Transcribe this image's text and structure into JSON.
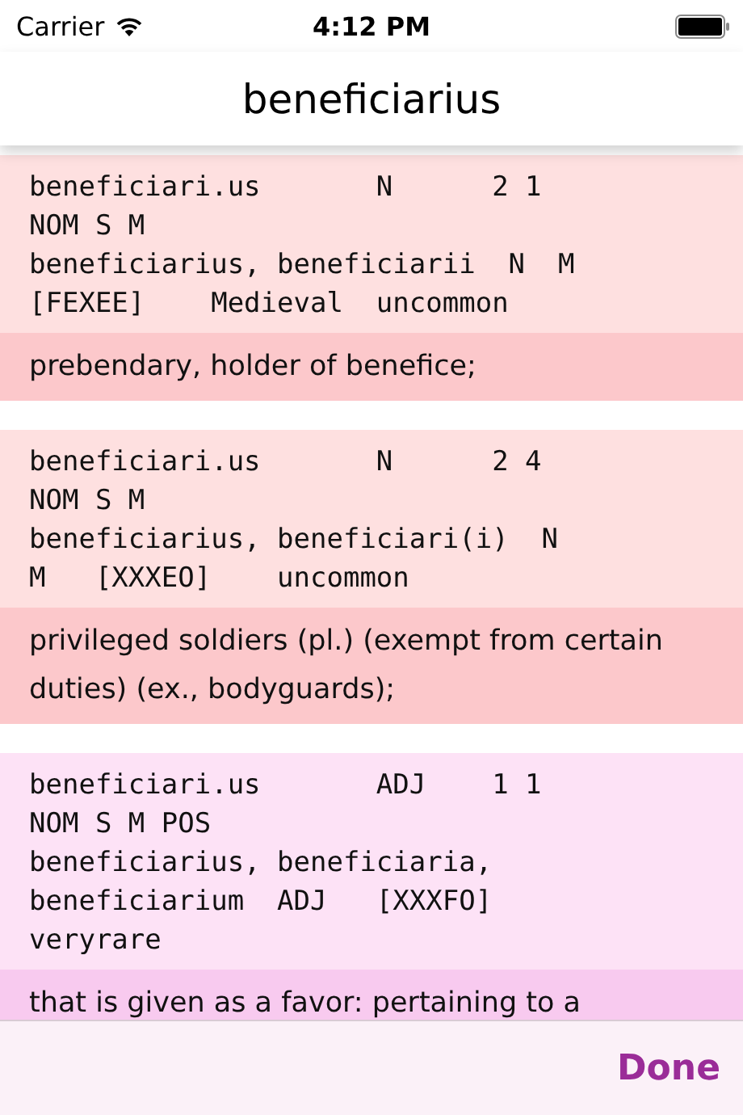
{
  "status_bar": {
    "carrier": "Carrier",
    "time": "4:12 PM"
  },
  "nav": {
    "title": "beneficiarius"
  },
  "entries": [
    {
      "color": "#fee0e0",
      "lines": [
        "beneficiari.us       N      2 1",
        "NOM S M",
        "beneficiarius, beneficiarii  N  M",
        "[FEXEE]    Medieval  uncommon"
      ],
      "definition": "prebendary, holder of benefice;"
    },
    {
      "color": "#fee0e0",
      "lines": [
        "beneficiari.us       N      2 4",
        "NOM S M",
        "beneficiarius, beneficiari(i)  N",
        "M   [XXXEO]    uncommon"
      ],
      "definition": "privileged soldiers (pl.) (exempt from certain duties) (ex., bodyguards);"
    },
    {
      "color": "#fde2f6",
      "lines": [
        "beneficiari.us       ADJ    1 1",
        "NOM S M POS",
        "beneficiarius, beneficiaria,",
        "beneficiarium  ADJ   [XXXFO]",
        "veryrare"
      ],
      "definition": "that is given as a favor: pertaining to a"
    }
  ],
  "toolbar": {
    "done": "Done"
  }
}
